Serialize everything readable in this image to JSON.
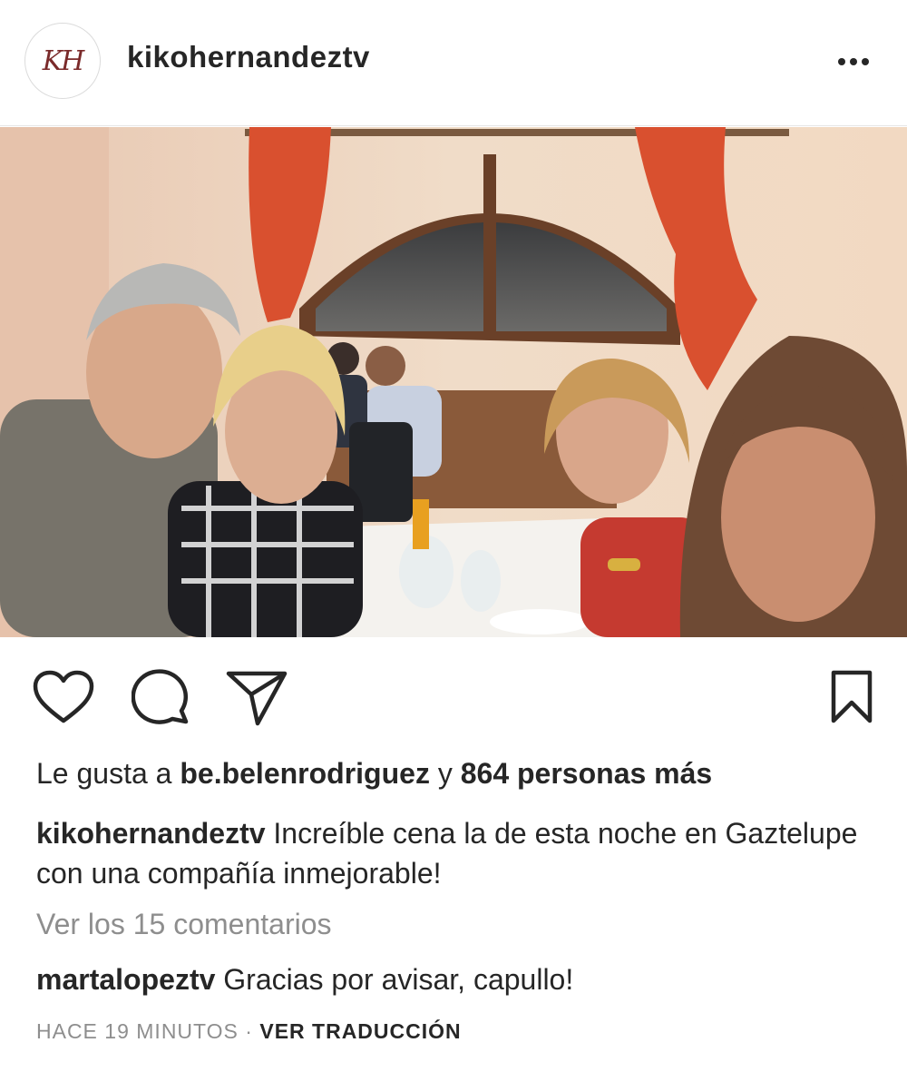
{
  "header": {
    "avatar_monogram": "KH",
    "username": "kikohernandeztv",
    "more_icon": "more-horizontal-icon"
  },
  "post": {
    "image_alt": "selfie at restaurant dinner",
    "actions": {
      "like_icon": "heart-icon",
      "comment_icon": "comment-bubble-icon",
      "share_icon": "paper-plane-icon",
      "save_icon": "bookmark-icon"
    },
    "likes": {
      "prefix": "Le gusta a",
      "user": "be.belenrodriguez",
      "joiner": "y",
      "others": "864 personas más"
    },
    "caption": {
      "author": "kikohernandeztv",
      "text": "Increíble cena la de esta noche en Gaztelupe con una compañía inmejorable!"
    },
    "view_comments": "Ver los 15 comentarios",
    "top_comment": {
      "author": "martalopeztv",
      "text": "Gracias por avisar, capullo!"
    },
    "timestamp": "HACE 19 MINUTOS",
    "separator": "·",
    "translate": "VER TRADUCCIÓN"
  },
  "colors": {
    "text": "#262626",
    "secondary": "#8e8e8e",
    "curtain": "#d9502f"
  }
}
